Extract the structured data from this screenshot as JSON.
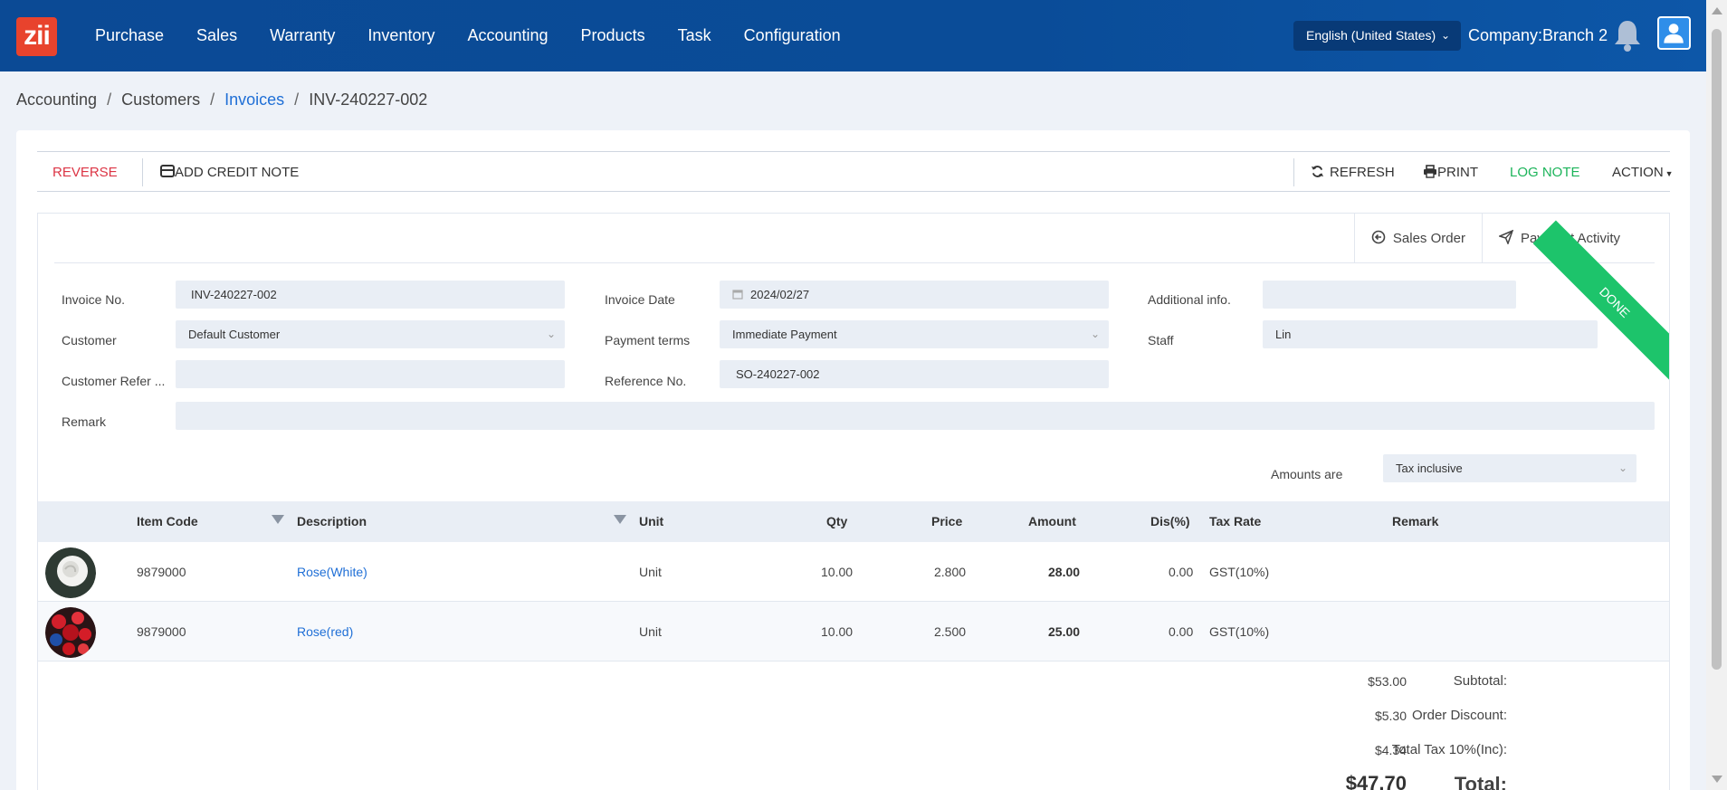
{
  "header": {
    "logo": "zii",
    "nav": [
      "Purchase",
      "Sales",
      "Warranty",
      "Inventory",
      "Accounting",
      "Products",
      "Task",
      "Configuration"
    ],
    "language": "English (United States)",
    "company": "Company:Branch 2"
  },
  "breadcrumb": {
    "b1": "Accounting",
    "b2": "Customers",
    "b3": "Invoices",
    "b4": "INV-240227-002",
    "sep": "/"
  },
  "toolbar": {
    "reverse": "REVERSE",
    "add_credit_note": "ADD CREDIT NOTE",
    "refresh": "REFRESH",
    "print": "PRINT",
    "log_note": "LOG NOTE",
    "action": "ACTION"
  },
  "smart_buttons": {
    "sales_order": "Sales Order",
    "payment_activity": "Payment Activity"
  },
  "status_ribbon": "DONE",
  "form": {
    "invoice_no_label": "Invoice No.",
    "invoice_no": "INV-240227-002",
    "customer_label": "Customer",
    "customer": "Default Customer",
    "customer_ref_label": "Customer Refer ...",
    "customer_ref": "",
    "remark_label": "Remark",
    "remark": "",
    "invoice_date_label": "Invoice Date",
    "invoice_date": "2024/02/27",
    "payment_terms_label": "Payment terms",
    "payment_terms": "Immediate Payment",
    "reference_no_label": "Reference No.",
    "reference_no": "SO-240227-002",
    "additional_info_label": "Additional info.",
    "additional_info": "",
    "staff_label": "Staff",
    "staff": "Lin",
    "amounts_are_label": "Amounts are",
    "amounts_are": "Tax inclusive"
  },
  "table": {
    "columns": {
      "item_code": "Item Code",
      "description": "Description",
      "unit": "Unit",
      "qty": "Qty",
      "price": "Price",
      "amount": "Amount",
      "dis": "Dis(%)",
      "tax_rate": "Tax Rate",
      "remark": "Remark"
    },
    "rows": [
      {
        "item_code": "9879000",
        "description": "Rose(White)",
        "unit": "Unit",
        "qty": "10.00",
        "price": "2.800",
        "amount": "28.00",
        "dis": "0.00",
        "tax_rate": "GST(10%)",
        "remark": ""
      },
      {
        "item_code": "9879000",
        "description": "Rose(red)",
        "unit": "Unit",
        "qty": "10.00",
        "price": "2.500",
        "amount": "25.00",
        "dis": "0.00",
        "tax_rate": "GST(10%)",
        "remark": ""
      }
    ]
  },
  "totals": {
    "subtotal_label": "Subtotal:",
    "subtotal": "$53.00",
    "discount_label": "Order Discount:",
    "discount": "$5.30",
    "tax_label": "Total Tax 10%(Inc):",
    "tax": "$4.34",
    "total_label": "Total:",
    "total": "$47.70"
  }
}
